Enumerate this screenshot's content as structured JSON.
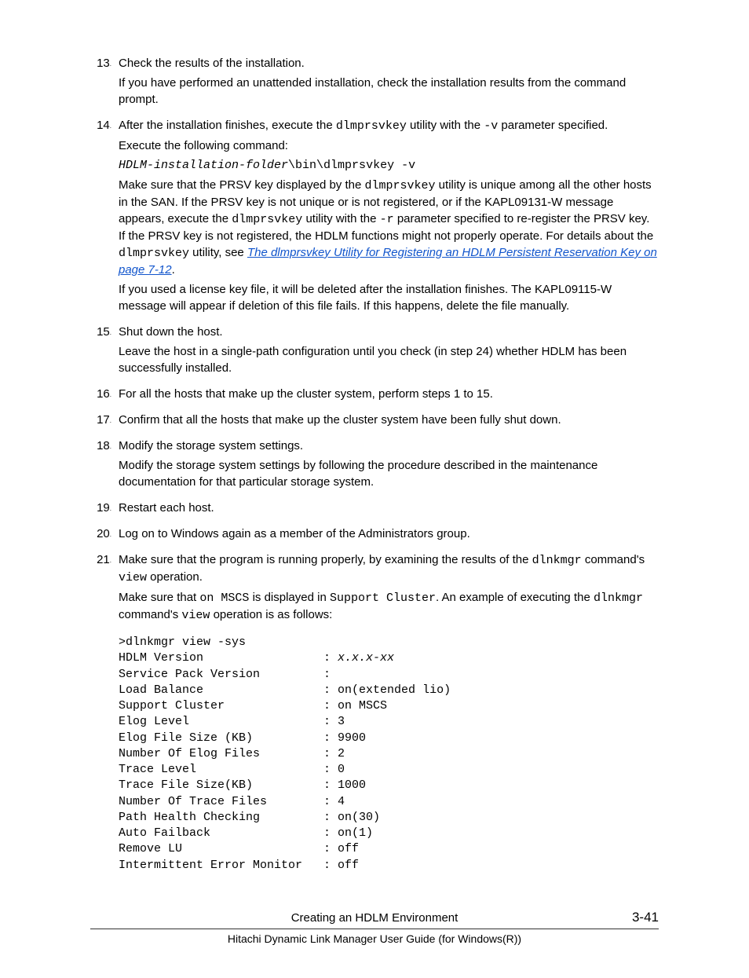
{
  "steps": {
    "s13": {
      "num": "13",
      "p1": "Check the results of the installation.",
      "p2": "If you have performed an unattended installation, check the installation results from the command prompt."
    },
    "s14": {
      "num": "14",
      "p1a": "After the installation finishes, execute the ",
      "p1b": "dlmprsvkey",
      "p1c": " utility with the ",
      "p1d": "-v",
      "p1e": " parameter specified.",
      "p2": "Execute the following command:",
      "cmd_a": "HDLM-installation-folder",
      "cmd_b": "\\bin\\dlmprsvkey -v",
      "p3a": "Make sure that the PRSV key displayed by the ",
      "p3b": "dlmprsvkey",
      "p3c": " utility is unique among all the other hosts in the SAN. If the PRSV key is not unique or is not registered, or if the KAPL09131-W message appears, execute the ",
      "p3d": "dlmprsvkey",
      "p3e": " utility with the ",
      "p3f": "-r",
      "p3g": " parameter specified to re-register the PRSV key. If the PRSV key is not registered, the HDLM functions might not properly operate. For details about the ",
      "p3h": "dlmprsvkey",
      "p3i": " utility, see ",
      "link": "The dlmprsvkey Utility for Registering an HDLM Persistent Reservation Key on page 7-12",
      "p3j": ".",
      "p4": "If you used a license key file, it will be deleted after the installation finishes. The KAPL09115-W message will appear if deletion of this file fails. If this happens, delete the file manually."
    },
    "s15": {
      "num": "15",
      "p1": "Shut down the host.",
      "p2": "Leave the host in a single-path configuration until you check (in step 24) whether HDLM has been successfully installed."
    },
    "s16": {
      "num": "16",
      "p1": "For all the hosts that make up the cluster system, perform steps 1 to 15."
    },
    "s17": {
      "num": "17",
      "p1": "Confirm that all the hosts that make up the cluster system have been fully shut down."
    },
    "s18": {
      "num": "18",
      "p1": "Modify the storage system settings.",
      "p2": "Modify the storage system settings by following the procedure described in the maintenance documentation for that particular storage system."
    },
    "s19": {
      "num": "19",
      "p1": "Restart each host."
    },
    "s20": {
      "num": "20",
      "p1": "Log on to Windows again as a member of the Administrators group."
    },
    "s21": {
      "num": "21",
      "p1a": "Make sure that the program is running properly, by examining the results of the ",
      "p1b": "dlnkmgr",
      "p1c": " command's ",
      "p1d": "view",
      "p1e": " operation.",
      "p2a": "Make sure that ",
      "p2b": "on MSCS",
      "p2c": " is displayed in ",
      "p2d": "Support Cluster",
      "p2e": ". An example of executing the ",
      "p2f": "dlnkmgr",
      "p2g": " command's ",
      "p2h": "view",
      "p2i": " operation is as follows:",
      "out_cmd": ">dlnkmgr view -sys",
      "out_l1a": "HDLM Version                 : ",
      "out_l1b": "x.x.x-xx",
      "out_l2": "Service Pack Version         :",
      "out_l3": "Load Balance                 : on(extended lio)",
      "out_l4": "Support Cluster              : on MSCS",
      "out_l5": "Elog Level                   : 3",
      "out_l6": "Elog File Size (KB)          : 9900",
      "out_l7": "Number Of Elog Files         : 2",
      "out_l8": "Trace Level                  : 0",
      "out_l9": "Trace File Size(KB)          : 1000",
      "out_l10": "Number Of Trace Files        : 4",
      "out_l11": "Path Health Checking         : on(30)",
      "out_l12": "Auto Failback                : on(1)",
      "out_l13": "Remove LU                    : off",
      "out_l14": "Intermittent Error Monitor   : off"
    }
  },
  "footer": {
    "title": "Creating an HDLM Environment",
    "page": "3-41",
    "sub": "Hitachi Dynamic Link Manager User Guide (for Windows(R))"
  }
}
